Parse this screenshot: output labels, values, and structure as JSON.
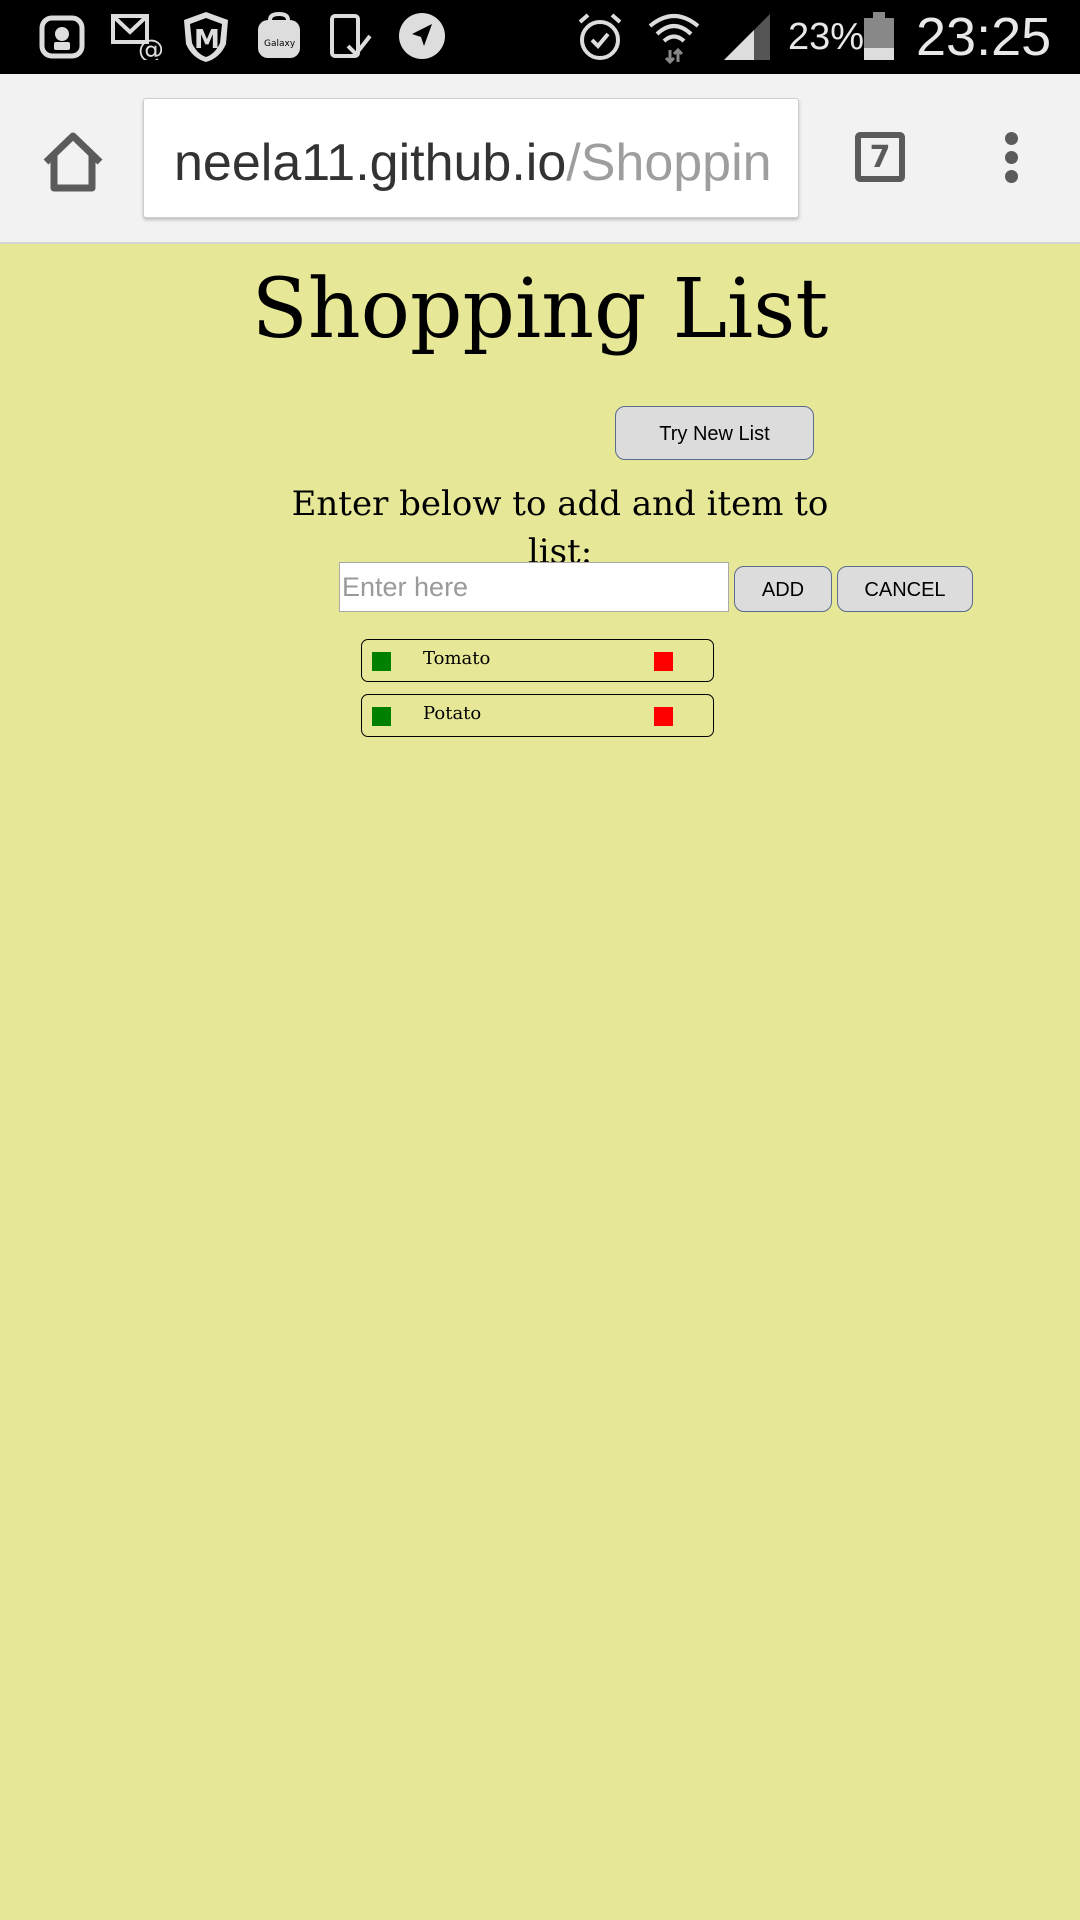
{
  "status_bar": {
    "battery_percent": "23%",
    "time": "23:25",
    "icons": [
      "game-controller-icon",
      "email-at-icon",
      "shield-m-icon",
      "galaxy-apps-icon",
      "download-check-icon",
      "navigation-icon",
      "alarm-icon",
      "wifi-icon",
      "signal-icon",
      "battery-icon"
    ]
  },
  "browser": {
    "url_host": "neela11.github.io",
    "url_path": "/Shoppin",
    "tab_count": "7",
    "colors": {
      "url_host": "#333333",
      "url_path": "#9e9e9e"
    }
  },
  "page": {
    "title": "Shopping List",
    "try_new_list_label": "Try New List",
    "instructions": "Enter below to add and item to list:",
    "input": {
      "placeholder": "Enter here",
      "value": ""
    },
    "add_label": "ADD",
    "cancel_label": "CANCEL",
    "items": [
      {
        "name": "Tomato"
      },
      {
        "name": "Potato"
      }
    ],
    "colors": {
      "background": "#e6e797",
      "check": "#008000",
      "remove": "#ff0000"
    }
  }
}
